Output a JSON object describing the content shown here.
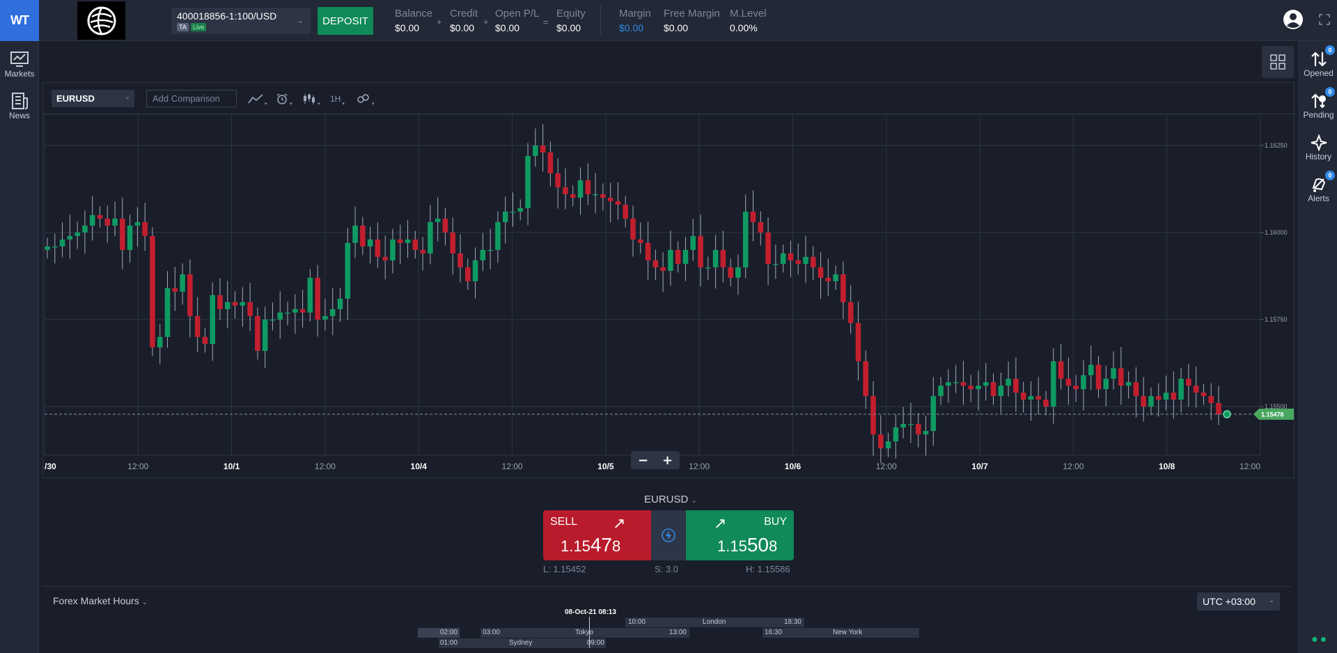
{
  "brand": {
    "logo_text": "WT"
  },
  "account": {
    "id": "400018856-1:100/USD",
    "tag_ta": "TA",
    "tag_live": "Live"
  },
  "deposit_label": "DEPOSIT",
  "stats": {
    "balance": {
      "label": "Balance",
      "value": "$0.00"
    },
    "credit": {
      "label": "Credit",
      "value": "$0.00"
    },
    "open_pl": {
      "label": "Open P/L",
      "value": "$0.00"
    },
    "equity": {
      "label": "Equity",
      "value": "$0.00"
    },
    "margin": {
      "label": "Margin",
      "value": "$0.00"
    },
    "free_margin": {
      "label": "Free Margin",
      "value": "$0.00"
    },
    "m_level": {
      "label": "M.Level",
      "value": "0.00%"
    },
    "op_plus": "+",
    "op_eq": "="
  },
  "left_nav": [
    {
      "label": "Markets",
      "icon": "markets-icon"
    },
    {
      "label": "News",
      "icon": "news-icon"
    }
  ],
  "right_nav": [
    {
      "label": "Opened",
      "count": "0"
    },
    {
      "label": "Pending",
      "count": "0"
    },
    {
      "label": "History"
    },
    {
      "label": "Alerts",
      "count": "0"
    }
  ],
  "chart_toolbar": {
    "symbol": "EURUSD",
    "compare_placeholder": "Add Comparison",
    "interval": "1H"
  },
  "chart_data": {
    "type": "candlestick",
    "symbol": "EURUSD",
    "x_labels": [
      "/30",
      "12:00",
      "10/1",
      "12:00",
      "10/4",
      "12:00",
      "10/5",
      "12:00",
      "10/6",
      "12:00",
      "10/7",
      "12:00",
      "10/8",
      "12:00"
    ],
    "y_ticks": [
      "1.16250",
      "1.16000",
      "1.15750",
      "1.15500"
    ],
    "ylim": [
      1.1536,
      1.1634
    ],
    "current_price_label": "1.15478",
    "current_price": 1.15478,
    "closes": [
      1.1596,
      1.1596,
      1.1598,
      1.1599,
      1.16,
      1.1602,
      1.1605,
      1.1604,
      1.1602,
      1.1604,
      1.1595,
      1.1602,
      1.1603,
      1.1599,
      1.1567,
      1.157,
      1.1584,
      1.1583,
      1.1588,
      1.1576,
      1.157,
      1.1568,
      1.1582,
      1.1578,
      1.158,
      1.1579,
      1.158,
      1.1576,
      1.1566,
      1.1575,
      1.1575,
      1.1577,
      1.1577,
      1.1578,
      1.1577,
      1.1587,
      1.1575,
      1.1576,
      1.1578,
      1.1581,
      1.1597,
      1.1602,
      1.1596,
      1.1598,
      1.1593,
      1.1592,
      1.1598,
      1.1597,
      1.1598,
      1.1595,
      1.1594,
      1.1603,
      1.1604,
      1.16,
      1.1594,
      1.159,
      1.1586,
      1.1592,
      1.1595,
      1.1595,
      1.1603,
      1.1606,
      1.1606,
      1.1607,
      1.1622,
      1.1625,
      1.1623,
      1.1617,
      1.1613,
      1.1611,
      1.161,
      1.1615,
      1.1611,
      1.1611,
      1.161,
      1.1609,
      1.1608,
      1.1604,
      1.1598,
      1.1597,
      1.1592,
      1.159,
      1.1589,
      1.1595,
      1.1591,
      1.1595,
      1.1599,
      1.159,
      1.159,
      1.1595,
      1.159,
      1.1587,
      1.159,
      1.1606,
      1.1603,
      1.16,
      1.1591,
      1.1591,
      1.1594,
      1.1592,
      1.1591,
      1.1593,
      1.159,
      1.1587,
      1.1586,
      1.1588,
      1.158,
      1.1574,
      1.1563,
      1.1553,
      1.1542,
      1.1538,
      1.154,
      1.1544,
      1.1545,
      1.1545,
      1.1542,
      1.1543,
      1.1553,
      1.1556,
      1.1557,
      1.1557,
      1.1556,
      1.1555,
      1.1556,
      1.1557,
      1.1553,
      1.1556,
      1.1558,
      1.1554,
      1.1552,
      1.1553,
      1.1552,
      1.155,
      1.1563,
      1.1558,
      1.1556,
      1.1555,
      1.1559,
      1.1562,
      1.1555,
      1.1558,
      1.1561,
      1.1556,
      1.1557,
      1.1553,
      1.155,
      1.1553,
      1.1552,
      1.1554,
      1.1552,
      1.1558,
      1.1556,
      1.1554,
      1.1553,
      1.1551,
      1.15478
    ]
  },
  "trade": {
    "symbol": "EURUSD",
    "sell_label": "SELL",
    "buy_label": "BUY",
    "sell_price_main": "1.15",
    "sell_price_big": "47",
    "sell_price_tail": "8",
    "buy_price_main": "1.15",
    "buy_price_big": "50",
    "buy_price_tail": "8",
    "low": "L: 1.15452",
    "spread": "S: 3.0",
    "high": "H: 1.15586"
  },
  "market_hours": {
    "title": "Forex Market Hours",
    "timezone": "UTC +03:00",
    "now": "08-Oct-21 08:13",
    "sessions": [
      {
        "name": "London",
        "open": "10:00",
        "close": "18:30"
      },
      {
        "name": "Tokyo",
        "open": "03:00",
        "close": "13:00"
      },
      {
        "name": "New York",
        "open": "16:30",
        "close": ""
      },
      {
        "name": "Sydney",
        "open": "01:00",
        "close": "09:00"
      },
      {
        "name": "",
        "open": "02:00",
        "close": ""
      }
    ]
  },
  "colors": {
    "up": "#0f9a62",
    "down": "#c21f2e",
    "accent": "#2f6fde",
    "margin_value": "#2f8ae4"
  }
}
